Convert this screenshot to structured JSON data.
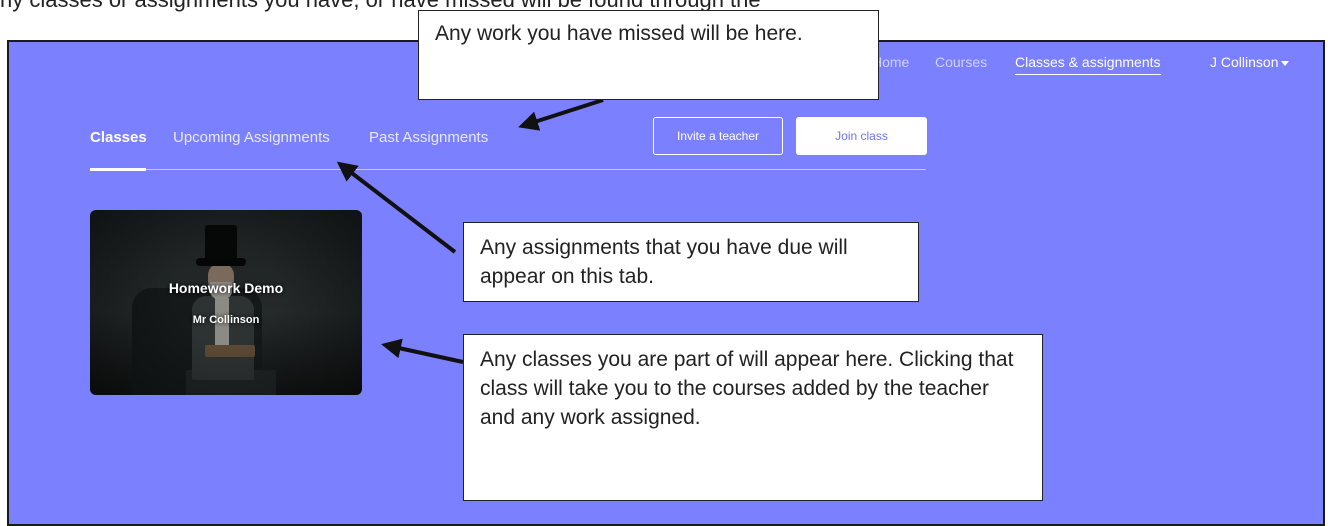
{
  "page": {
    "top_text": "ny classes or assignments you have, or have missed will be found through the"
  },
  "topnav": {
    "home": "Home",
    "courses": "Courses",
    "classes": "Classes & assignments",
    "user": "J Collinson"
  },
  "tabs": {
    "classes": "Classes",
    "upcoming": "Upcoming Assignments",
    "past": "Past Assignments",
    "active": "Classes"
  },
  "buttons": {
    "invite": "Invite a teacher",
    "join": "Join class"
  },
  "class_card": {
    "title": "Homework Demo",
    "teacher": "Mr Collinson"
  },
  "callouts": {
    "missed": "Any work you have missed will be here.",
    "assignments": "Any assignments that you have due will appear on this tab.",
    "classes": "Any classes you are part of will appear here. Clicking that class will take you to the courses added by the teacher and any work assigned."
  },
  "colors": {
    "background": "#7b80fe",
    "active_text": "#ffffff",
    "join_button_text": "#6f74ee"
  }
}
